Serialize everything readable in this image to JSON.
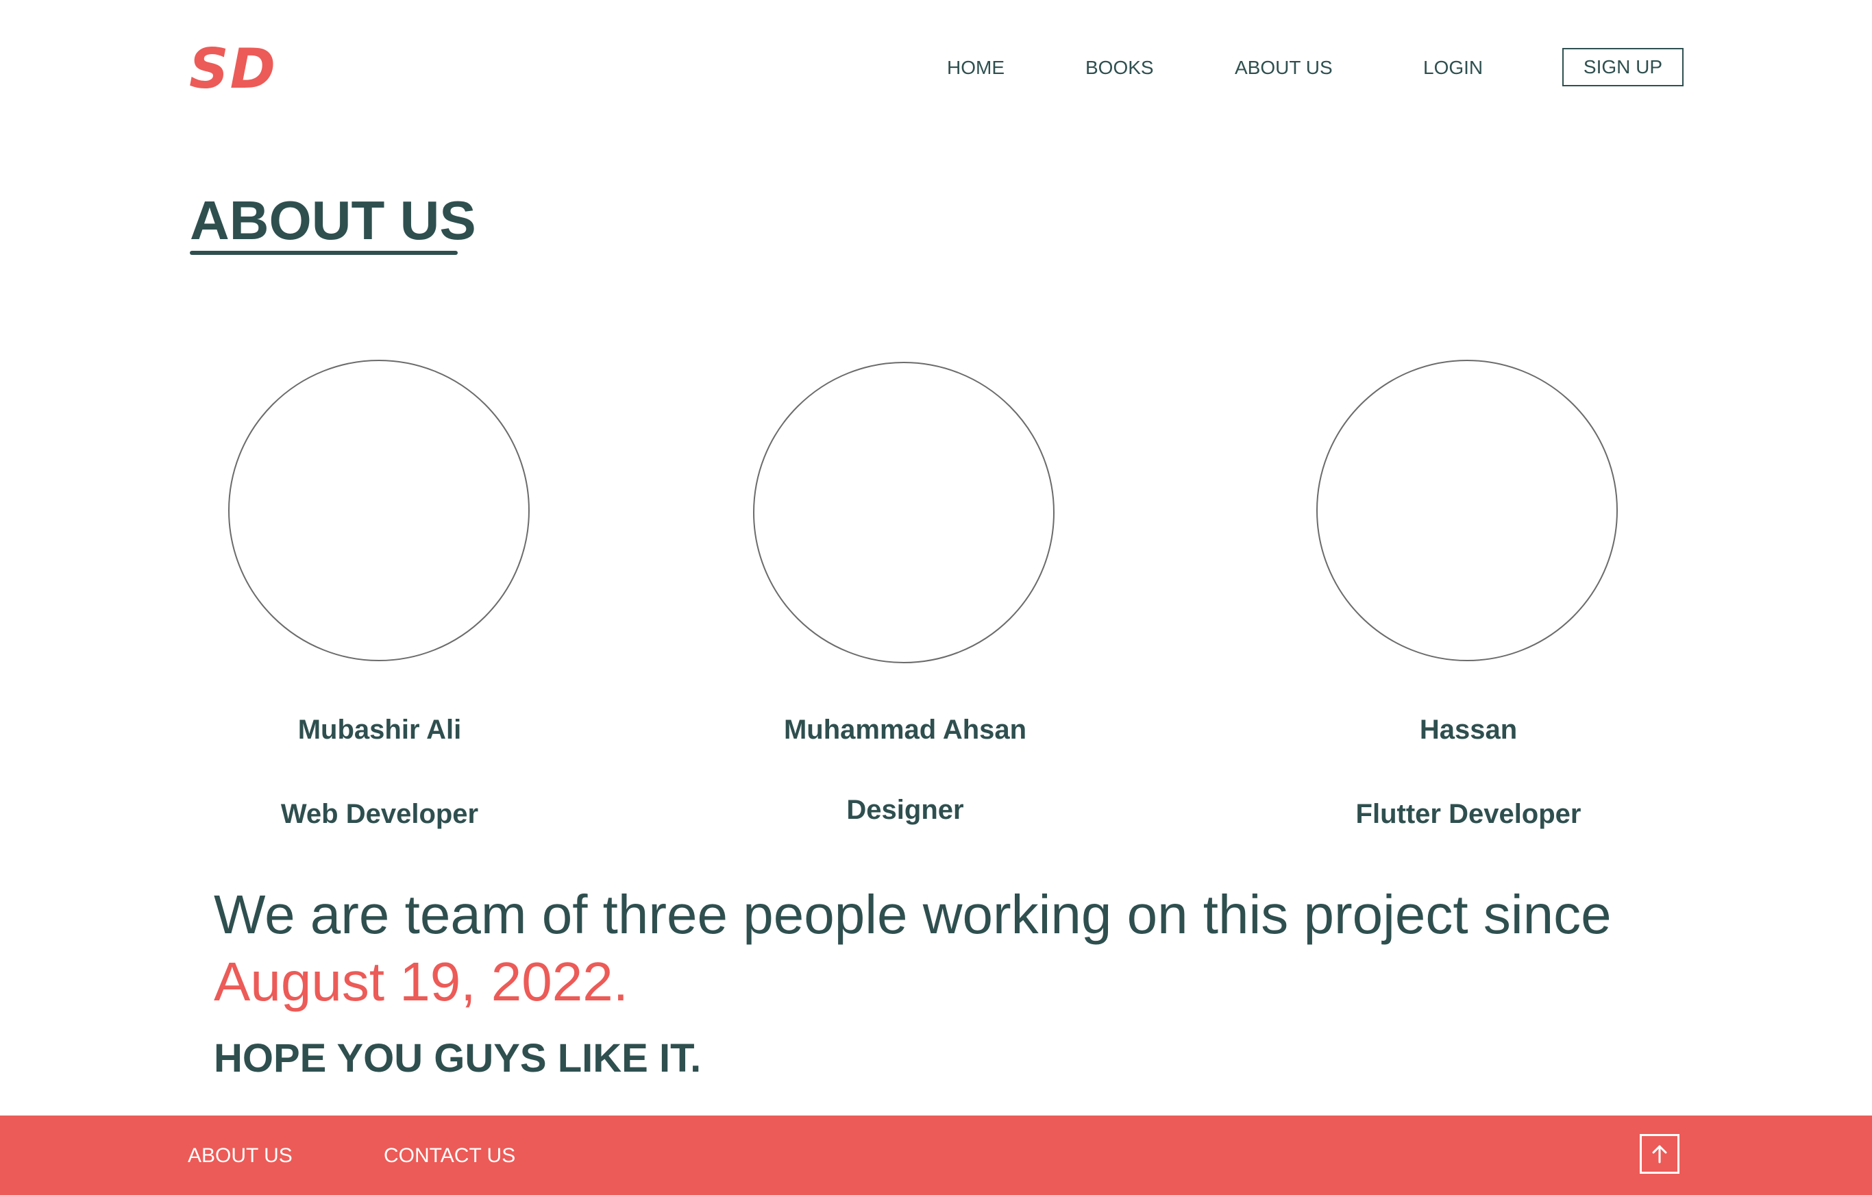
{
  "header": {
    "logo": "SD",
    "nav": {
      "home": "HOME",
      "books": "BOOKS",
      "about": "ABOUT US",
      "login": "LOGIN",
      "signup": "SIGN UP"
    }
  },
  "main": {
    "title": "ABOUT US",
    "team": [
      {
        "name": "Mubashir Ali",
        "role": "Web Developer"
      },
      {
        "name": "Muhammad Ahsan",
        "role": "Designer"
      },
      {
        "name": "Hassan",
        "role": "Flutter Developer"
      }
    ],
    "description": "We are team of three people working on this project since",
    "date": "August 19, 2022",
    "date_suffix": ".",
    "closing": "HOPE YOU GUYS LIKE IT."
  },
  "footer": {
    "about": "ABOUT US",
    "contact": "CONTACT US",
    "back_to_top_icon": "arrow-up-icon"
  },
  "colors": {
    "accent": "#ec5b57",
    "text": "#2f4f4f",
    "background": "#ffffff"
  }
}
